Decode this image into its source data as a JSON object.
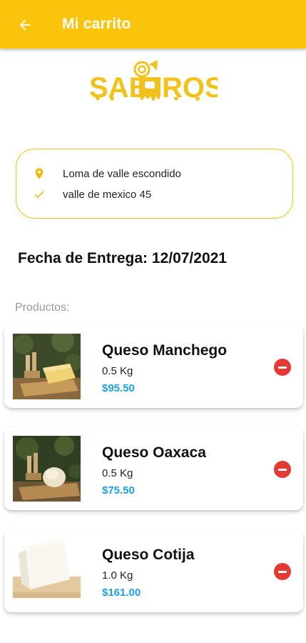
{
  "appbar": {
    "title": "Mi carrito",
    "back_icon": "arrow-left-icon",
    "color": "#fbc40c"
  },
  "brand": {
    "name": "SABOROSO",
    "color": "#f1c21c"
  },
  "address": {
    "line1": "Loma de valle escondido",
    "line2": "valle de mexico 45",
    "line1_icon": "location-pin-icon",
    "line2_icon": "check-icon"
  },
  "delivery": {
    "text": "Fecha de Entrega: 12/07/2021"
  },
  "products_label": "Productos:",
  "products": [
    {
      "name": "Queso Manchego",
      "qty": "0.5 Kg",
      "price": "$95.50",
      "remove_icon": "remove-circle-icon"
    },
    {
      "name": "Queso Oaxaca",
      "qty": "0.5 Kg",
      "price": "$75.50",
      "remove_icon": "remove-circle-icon"
    },
    {
      "name": "Queso Cotija",
      "qty": "1.0 Kg",
      "price": "$161.00",
      "remove_icon": "remove-circle-icon"
    }
  ],
  "colors": {
    "accent": "#fbc40c",
    "price": "#1e9fe0",
    "remove": "#e53935"
  }
}
